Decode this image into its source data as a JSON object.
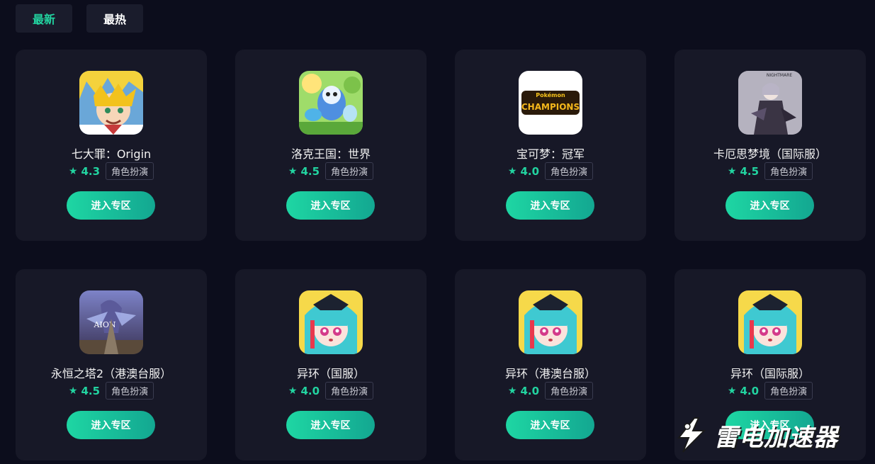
{
  "tabs": {
    "latest": "最新",
    "hot": "最热"
  },
  "enter_label": "进入专区",
  "cards": [
    {
      "name": "七大罪：Origin",
      "rating": "4.3",
      "tag": "角色扮演",
      "icon": "seven-deadly-sins-icon"
    },
    {
      "name": "洛克王国：世界",
      "rating": "4.5",
      "tag": "角色扮演",
      "icon": "roco-kingdom-icon"
    },
    {
      "name": "宝可梦：冠军",
      "rating": "4.0",
      "tag": "角色扮演",
      "icon": "pokemon-champions-icon",
      "icon_text": {
        "top": "Pokémon",
        "main": "CHAMPIONS"
      }
    },
    {
      "name": "卡厄思梦境（国际服）",
      "rating": "4.5",
      "tag": "角色扮演",
      "icon": "chaos-zero-nightmare-icon",
      "icon_text": {
        "top": "NIGHTMARE"
      }
    },
    {
      "name": "永恒之塔2（港澳台服）",
      "rating": "4.5",
      "tag": "角色扮演",
      "icon": "aion-2-icon",
      "icon_text": {
        "top": "AION"
      }
    },
    {
      "name": "异环（国服）",
      "rating": "4.0",
      "tag": "角色扮演",
      "icon": "neverness-to-everness-icon"
    },
    {
      "name": "异环（港澳台服）",
      "rating": "4.0",
      "tag": "角色扮演",
      "icon": "neverness-to-everness-icon"
    },
    {
      "name": "异环（国际服）",
      "rating": "4.0",
      "tag": "角色扮演",
      "icon": "neverness-to-everness-icon"
    }
  ],
  "watermark": "雷电加速器",
  "colors": {
    "background": "#0c0d1c",
    "card": "#171827",
    "accent": "#22d3a0"
  }
}
